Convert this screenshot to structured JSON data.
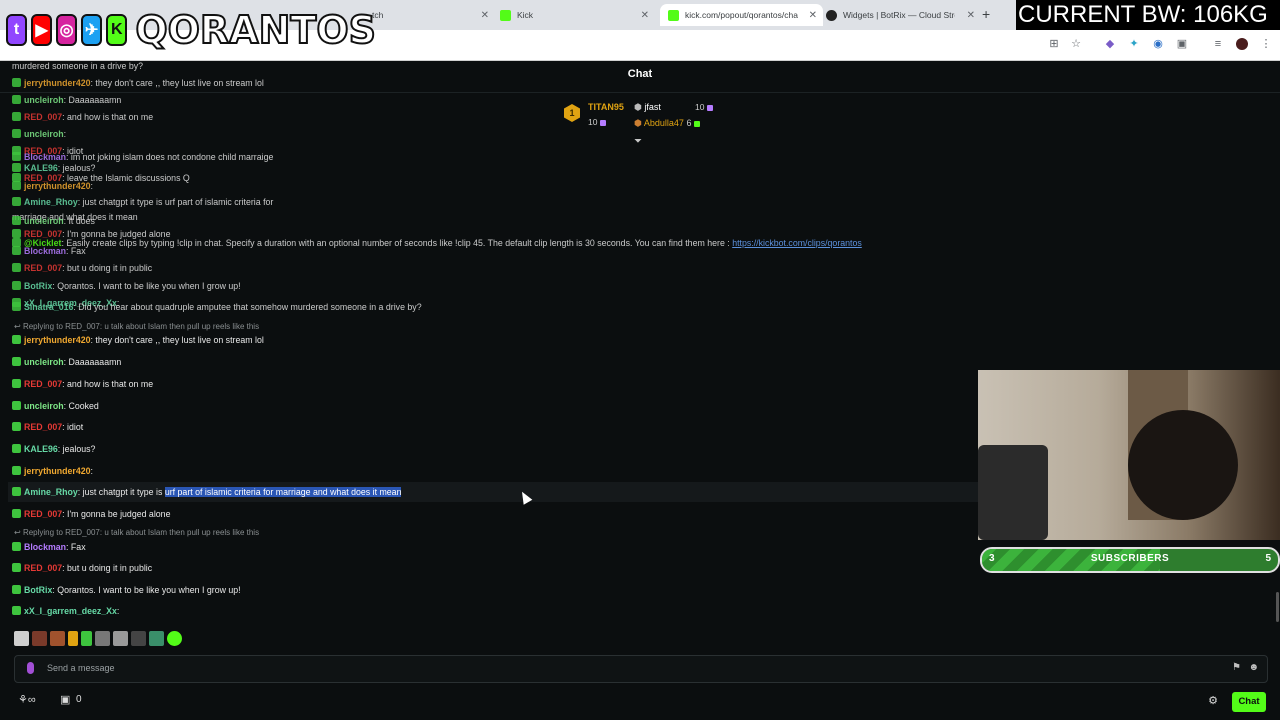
{
  "browser": {
    "tabs": [
      {
        "label": "tch",
        "favicon_color": "#9146ff"
      },
      {
        "label": "Kick",
        "favicon_color": "#53fc18"
      },
      {
        "label": "kick.com/popout/qorantos/cha",
        "favicon_color": "#53fc18"
      },
      {
        "label": "Widgets | BotRix — Cloud Strea",
        "favicon_color": "#222222"
      }
    ],
    "new_tab": "+"
  },
  "overlay": {
    "brand": "QORANTOS",
    "bandwidth": "CURRENT BW: 106KG",
    "social_icons": [
      "twitch-icon",
      "youtube-icon",
      "instagram-icon",
      "twitter-icon",
      "kick-icon"
    ]
  },
  "chat": {
    "title": "Chat",
    "leaderboard": {
      "first": {
        "rank": "1",
        "name": "TITAN95",
        "count": "10"
      },
      "second": {
        "name": "jfast",
        "count": "10"
      },
      "third": {
        "name": "Abdulla47",
        "count": "6"
      }
    },
    "ghost_messages": [
      {
        "user": "",
        "text": "murdered someone in a drive by?",
        "color": "#e8e8e8"
      },
      {
        "user": "jerrythunder420",
        "text": ": they don't care ,, they lust live on stream lol",
        "color": "#f0a830"
      },
      {
        "user": "uncleiroh",
        "text": ": Daaaaaaamn",
        "color": "#7ee787"
      },
      {
        "user": "RED_007",
        "text": ": and how is that on me",
        "color": "#e53935"
      },
      {
        "user": "uncleiroh",
        "text": ":",
        "color": "#7ee787"
      },
      {
        "user": "RED_007",
        "text": ": idiot",
        "color": "#e53935"
      },
      {
        "user": "Blockman",
        "text": ": im not joking islam does not condone child marraige",
        "color": "#b57cff"
      },
      {
        "user": "KALE96",
        "text": ": jealous?",
        "color": "#66d9a6"
      },
      {
        "user": "RED_007",
        "text": ": leave the Islamic discussions Q",
        "color": "#e53935"
      },
      {
        "user": "jerrythunder420",
        "text": ":",
        "color": "#f0a830"
      },
      {
        "user": "Amine_Rhoy",
        "text": ": just chatgpt it type is urf part of islamic criteria for",
        "color": "#66d9a6"
      },
      {
        "user": "",
        "text": "marriage and what does it mean",
        "color": "#e8e8e8"
      },
      {
        "user": "uncleiroh",
        "text": ": It does",
        "color": "#7ee787"
      },
      {
        "user": "RED_007",
        "text": ": I'm gonna be judged alone",
        "color": "#e53935"
      },
      {
        "user": "@Kicklet",
        "text": ": Easily create clips by typing !clip in chat. Specify a duration with an optional number of seconds like !clip 45. The default clip length is 30 seconds. You can find them here :",
        "color": "#53fc18",
        "link": "https://kickbot.com/clips/qorantos"
      },
      {
        "user": "Blockman",
        "text": ": Fax",
        "color": "#b57cff"
      },
      {
        "user": "RED_007",
        "text": ": but u doing it in public",
        "color": "#e53935"
      },
      {
        "user": "BotRix",
        "text": ": Qorantos. I want to be like you when I grow up!",
        "color": "#66d9a6"
      },
      {
        "user": "xX_I_garrem_deez_Xx",
        "text": ":",
        "color": "#66d9a6"
      },
      {
        "user": "Sinatra_016",
        "text": ": Did you hear about quadruple amputee that somehow murdered someone in a drive by?",
        "color": "#66d9a6"
      }
    ],
    "messages": [
      {
        "reply": "Replying to RED_007: u talk about Islam then pull up reels like this"
      },
      {
        "user": "jerrythunder420",
        "text": ": they don't care ,, they lust live on stream lol",
        "color": "#f0a830"
      },
      {
        "user": "uncleiroh",
        "text": ": Daaaaaaamn",
        "color": "#7ee787"
      },
      {
        "user": "RED_007",
        "text": ": and how is that on me",
        "color": "#e53935"
      },
      {
        "user": "uncleiroh",
        "text": ": Cooked",
        "color": "#7ee787"
      },
      {
        "user": "RED_007",
        "text": ": idiot",
        "color": "#e53935"
      },
      {
        "user": "KALE96",
        "text": ": jealous?",
        "color": "#66d9a6"
      },
      {
        "user": "jerrythunder420",
        "text": ":",
        "color": "#f0a830"
      },
      {
        "user": "Amine_Rhoy",
        "text": ": just chatgpt it type is ",
        "highlight": "urf part of islamic criteria for marriage and what does it mean",
        "color": "#66d9a6"
      },
      {
        "user": "RED_007",
        "text": ": I'm gonna be judged alone",
        "color": "#e53935"
      },
      {
        "reply": "Replying to RED_007: u talk about Islam then pull up reels like this"
      },
      {
        "user": "Blockman",
        "text": ": Fax",
        "color": "#b57cff"
      },
      {
        "user": "RED_007",
        "text": ": but u doing it in public",
        "color": "#e53935"
      },
      {
        "user": "BotRix",
        "text": ": Qorantos. I want to be like you when I grow up!",
        "color": "#66d9a6"
      },
      {
        "user": "xX_I_garrem_deez_Xx",
        "text": ":",
        "color": "#66d9a6"
      }
    ],
    "input_placeholder": "Send a message",
    "bottom_count": "0",
    "chat_button": "Chat"
  },
  "subs_goal": {
    "current": "3",
    "label": "SUBSCRIBERS",
    "target": "5",
    "progress": 0.6
  },
  "colors": {
    "background": "#0b0e0f",
    "kick_green": "#53fc18",
    "highlight": "#2a56b5"
  }
}
